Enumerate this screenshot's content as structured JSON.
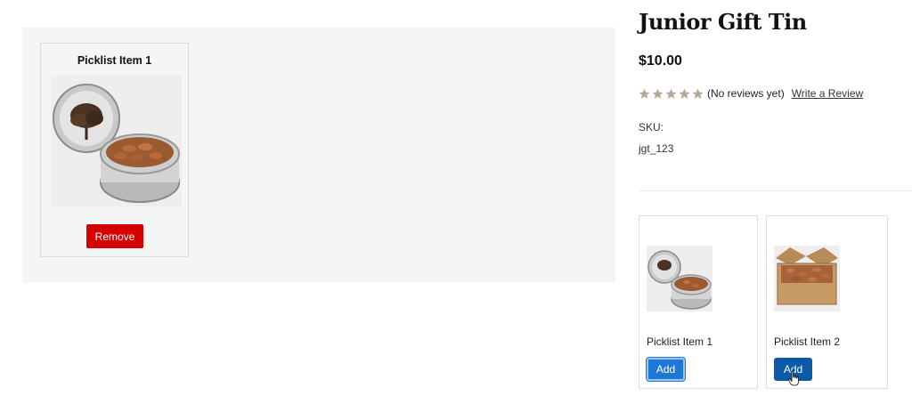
{
  "picked": {
    "title": "Picklist Item 1",
    "remove_label": "Remove"
  },
  "product": {
    "title": "Junior Gift Tin",
    "price": "$10.00",
    "rating_stars": 5,
    "reviews_text": "(No reviews yet)",
    "write_review_label": "Write a Review",
    "sku_label": "SKU:",
    "sku_value": "jgt_123"
  },
  "options": [
    {
      "label": "Picklist Item 1",
      "add_label": "Add",
      "state": "focused"
    },
    {
      "label": "Picklist Item 2",
      "add_label": "Add",
      "state": "hovered"
    }
  ],
  "colors": {
    "remove": "#d40000",
    "add_focused": "#1e78d6",
    "add_hover": "#0a5aa8",
    "star": "#b6aa96"
  }
}
